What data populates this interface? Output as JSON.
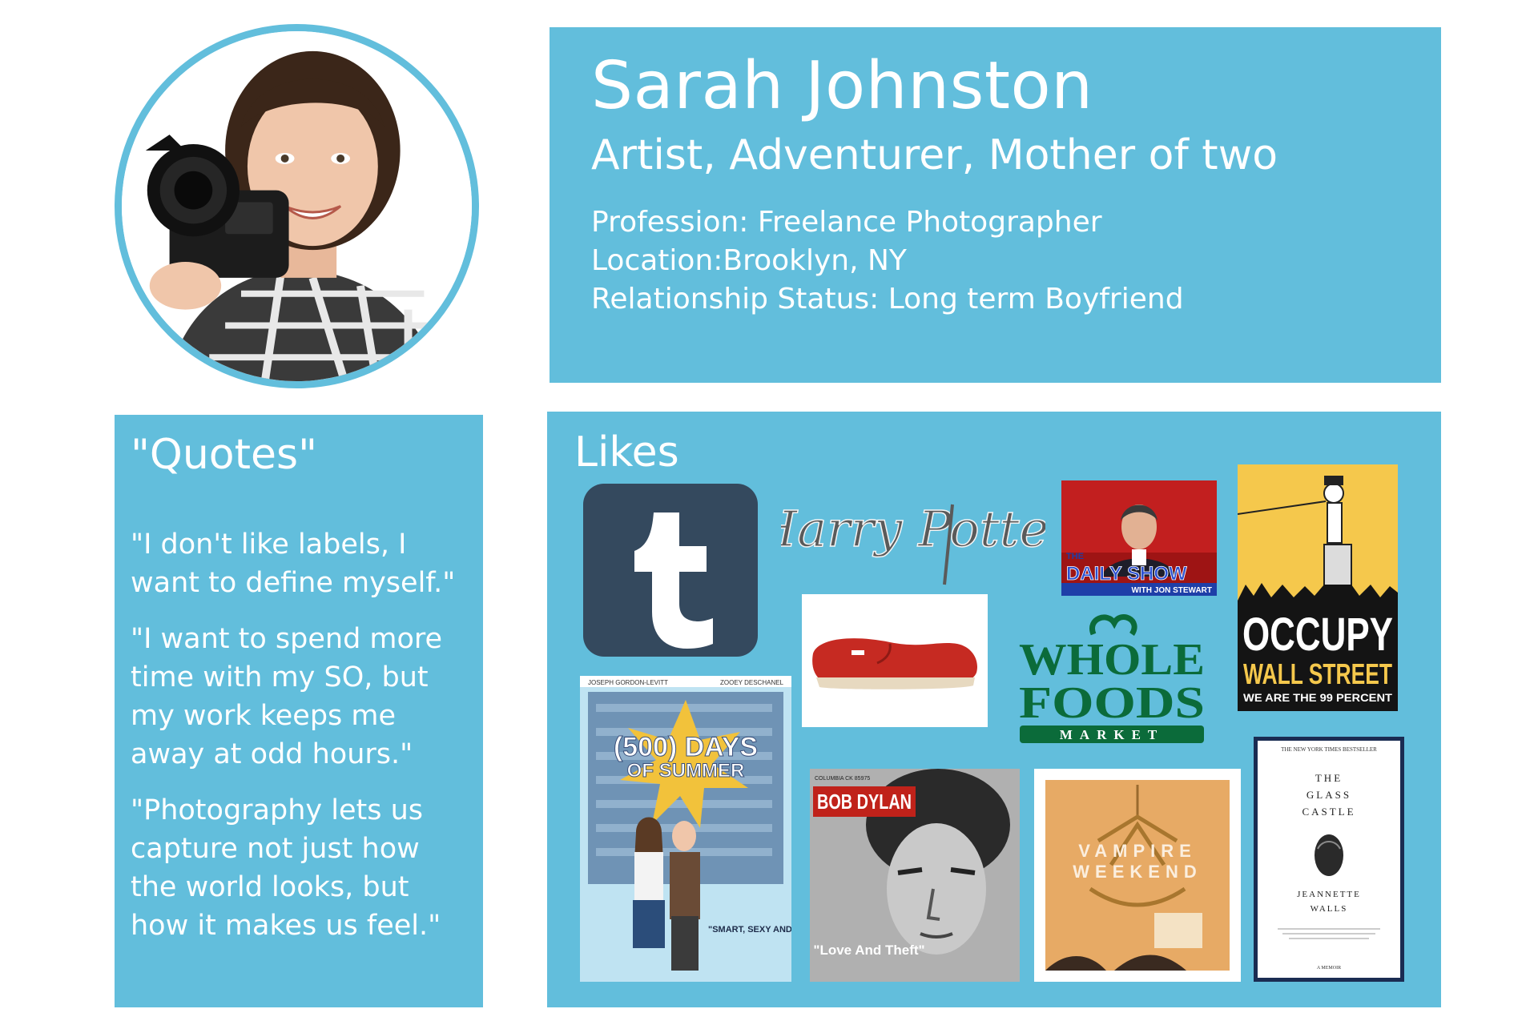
{
  "persona": {
    "name": "Sarah Johnston",
    "tagline": "Artist, Adventurer, Mother of two",
    "details": [
      "Profession: Freelance Photographer",
      "Location:Brooklyn, NY",
      "Relationship Status: Long term Boyfriend"
    ]
  },
  "quotes": {
    "title": "\"Quotes\"",
    "items": [
      "\"I don't like labels, I want to define myself.\"",
      "\"I want to spend more time with my SO, but my work keeps me away at odd hours.\"",
      "\"Photography lets us capture not just how the world looks, but how it makes us feel.\""
    ]
  },
  "likes": {
    "title": "Likes",
    "harry_potter": "Harry Potter",
    "daily_show": {
      "the": "THE",
      "title": "DAILY SHOW",
      "host": "WITH JON STEWART"
    },
    "occupy": {
      "line1": "OCCUPY",
      "line2": "WALL STREET",
      "line3": "WE ARE THE 99 PERCENT"
    },
    "whole_foods": {
      "line1": "WHOLE",
      "line2": "FOODS",
      "line3": "MARKET"
    },
    "summer": {
      "actors": [
        "JOSEPH GORDON-LEVITT",
        "ZOOEY DESCHANEL"
      ],
      "title1": "(500) DAYS",
      "title2": "OF SUMMER",
      "quote": "\"SMART, SEXY AND SERIOUSLY FUNNY!\""
    },
    "dylan": {
      "label": "COLUMBIA CK 85975",
      "artist": "BOB DYLAN",
      "album": "\"Love And Theft\""
    },
    "vampire": {
      "line1": "VAMPIRE",
      "line2": "WEEKEND"
    },
    "glass_castle": {
      "bestseller": "THE NEW YORK TIMES BESTSELLER",
      "title": [
        "THE",
        "GLASS",
        "CASTLE"
      ],
      "author": [
        "JEANNETTE",
        "WALLS"
      ],
      "subtitle": "A MEMOIR"
    }
  },
  "colors": {
    "panel": "#62bedc",
    "text": "#ffffff",
    "tumblr": "#34495e",
    "whole_foods": "#0b6b3a",
    "occupy_yellow": "#f5c84c"
  }
}
